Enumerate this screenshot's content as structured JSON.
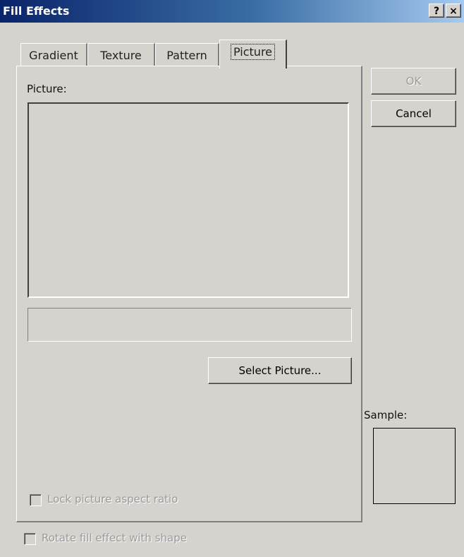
{
  "window": {
    "title": "Fill Effects",
    "help_button": "?",
    "close_button": "×"
  },
  "tabs": [
    {
      "label": "Gradient",
      "active": false
    },
    {
      "label": "Texture",
      "active": false
    },
    {
      "label": "Pattern",
      "active": false
    },
    {
      "label": "Picture",
      "active": true
    }
  ],
  "picture_tab": {
    "picture_label": "Picture:",
    "picture_name_value": "",
    "select_button": "Select Picture...",
    "lock_aspect_label": "Lock picture aspect ratio",
    "lock_aspect_checked": false,
    "lock_aspect_enabled": false
  },
  "buttons": {
    "ok": "OK",
    "ok_enabled": false,
    "cancel": "Cancel"
  },
  "sample": {
    "label": "Sample:"
  },
  "rotate": {
    "label": "Rotate fill effect with shape",
    "checked": false,
    "enabled": false
  }
}
